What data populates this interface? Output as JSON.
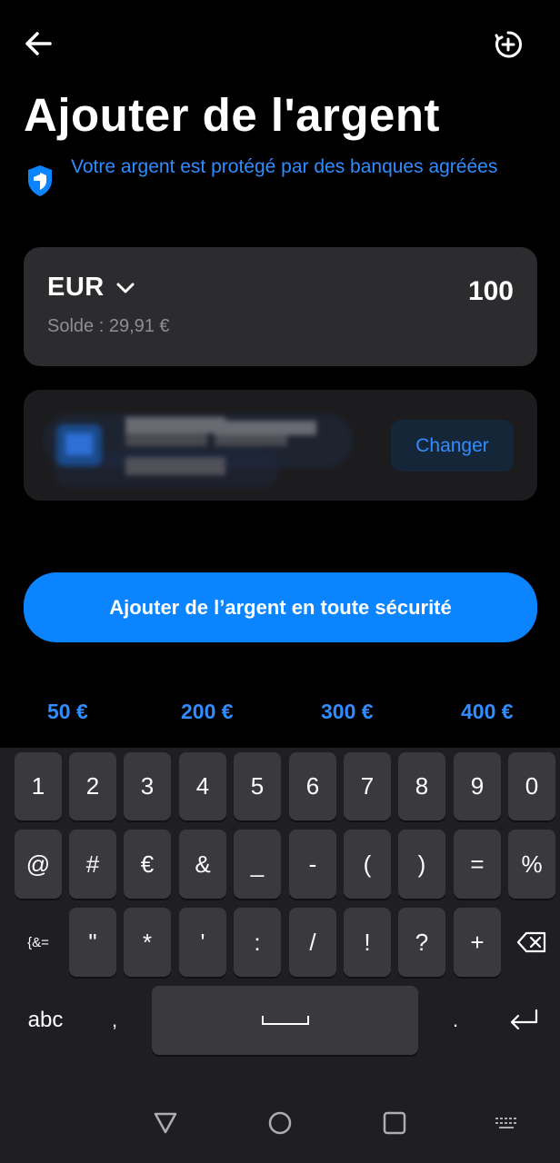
{
  "header": {
    "back_icon": "arrow-left-icon",
    "bonus_icon": "circle-plus-icon",
    "title": "Ajouter de l'argent"
  },
  "protection": {
    "icon": "shield-icon",
    "text": "Votre argent est protégé par des banques agréées"
  },
  "amount_card": {
    "currency": "EUR",
    "balance": "Solde : 29,91 €",
    "amount": "100"
  },
  "account_card": {
    "change_label": "Changer"
  },
  "primary_button": "Ajouter de l’argent en toute sécurité",
  "quick_amounts": [
    "50 €",
    "200 €",
    "300 €",
    "400 €"
  ],
  "keyboard": {
    "row1": [
      "1",
      "2",
      "3",
      "4",
      "5",
      "6",
      "7",
      "8",
      "9",
      "0"
    ],
    "row2": [
      "@",
      "#",
      "€",
      "&",
      "_",
      "-",
      "(",
      ")",
      "=",
      "%"
    ],
    "row3": [
      "\"",
      "*",
      "'",
      ":",
      "/",
      "!",
      "?",
      "+"
    ],
    "symbols_key": "{&=",
    "abc_key": "abc",
    "comma_key": ",",
    "period_key": "."
  },
  "colors": {
    "accent": "#0a84ff",
    "link": "#2f8dff",
    "card": "#2c2c2e",
    "background": "#000000"
  }
}
